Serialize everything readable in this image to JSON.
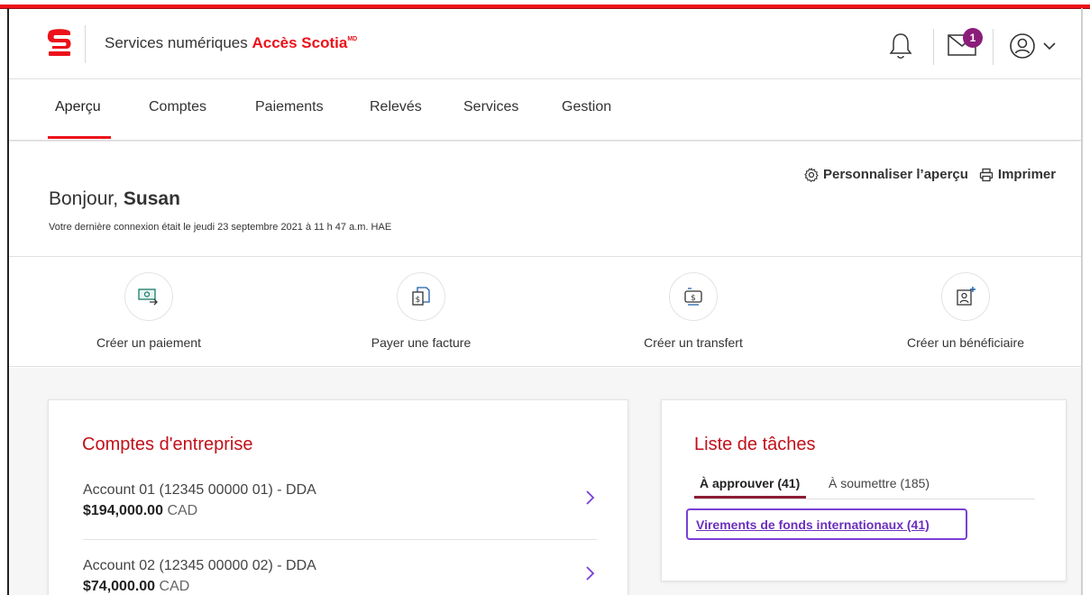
{
  "header": {
    "brand_prefix": "Services numériques",
    "brand_bold": "Accès Scotia",
    "brand_mark": "MD",
    "notification_count": "1"
  },
  "nav": {
    "items": [
      {
        "label": "Aperçu",
        "active": true
      },
      {
        "label": "Comptes"
      },
      {
        "label": "Paiements"
      },
      {
        "label": "Relevés"
      },
      {
        "label": "Services"
      },
      {
        "label": "Gestion"
      }
    ]
  },
  "greeting": {
    "hello": "Bonjour,",
    "name": "Susan",
    "last_login": "Votre dernière connexion était le jeudi 23 septembre 2021 à 11 h 47 a.m. HAE",
    "personalize_label": "Personnaliser l’aperçu",
    "print_label": "Imprimer"
  },
  "actions": [
    {
      "label": "Créer un paiement",
      "icon": "payment-icon"
    },
    {
      "label": "Payer une facture",
      "icon": "bill-icon"
    },
    {
      "label": "Créer un transfert",
      "icon": "transfer-icon"
    },
    {
      "label": "Créer un bénéficiaire",
      "icon": "add-payee-icon"
    }
  ],
  "accounts_card": {
    "title": "Comptes d'entreprise",
    "accounts": [
      {
        "name": "Account 01 (12345 00000 01) - DDA",
        "amount": "$194,000.00",
        "currency": "CAD"
      },
      {
        "name": "Account 02 (12345 00000 02) - DDA",
        "amount": "$74,000.00",
        "currency": "CAD"
      }
    ]
  },
  "tasks_card": {
    "title": "Liste de tâches",
    "tab_approve": "À approuver (41)",
    "tab_submit": "À soumettre (185)",
    "task_link": "Virements de fonds internationaux (41)"
  },
  "colors": {
    "brand_red": "#ec111a",
    "title_red": "#c1101a",
    "badge_purple": "#8b1d7a",
    "link_purple": "#6b2fbf"
  }
}
